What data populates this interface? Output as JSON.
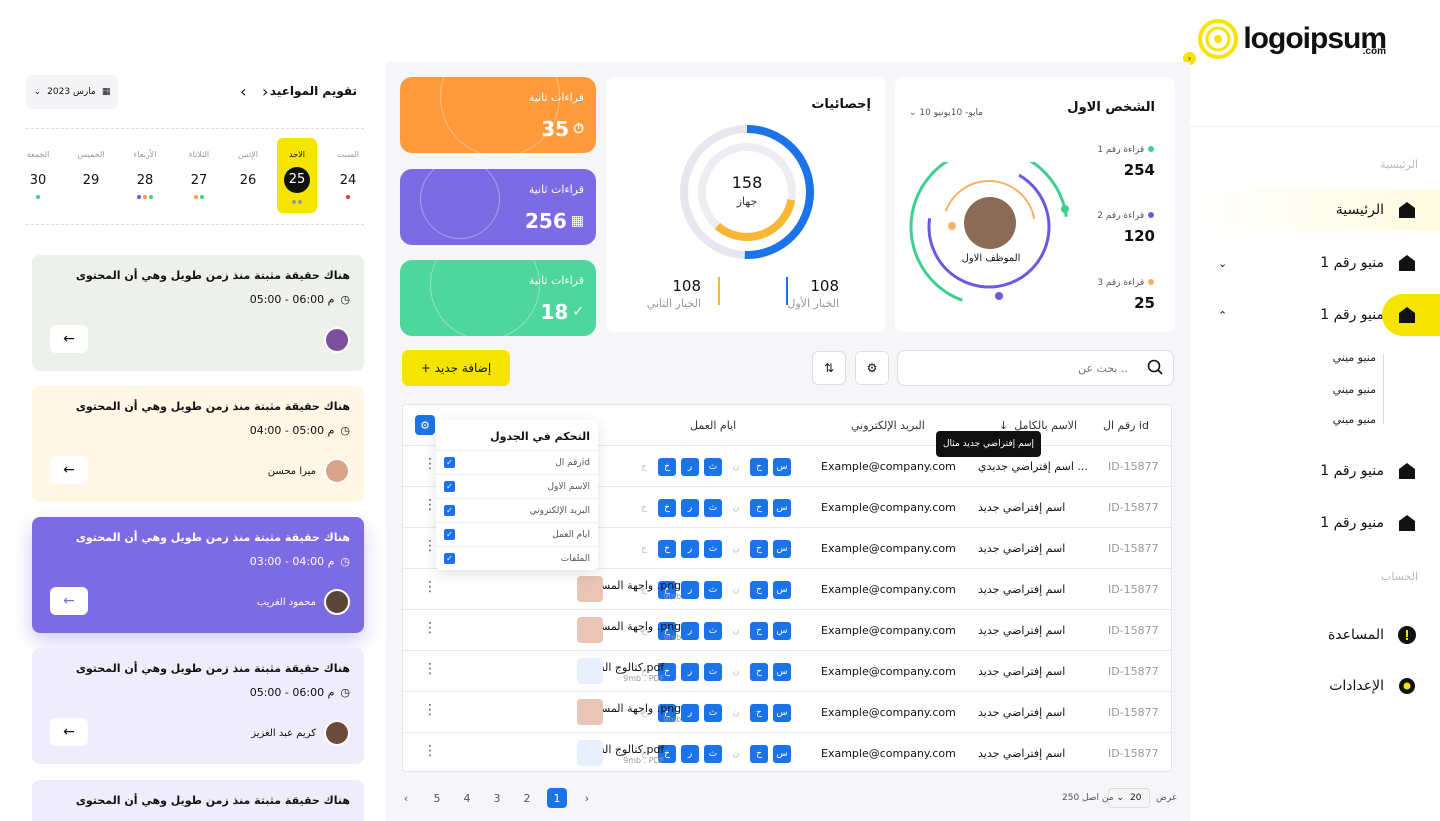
{
  "brand": {
    "name": "logoipsum",
    "suffix": ".com",
    "accent": "#f5e400",
    "blue": "#1a73e8"
  },
  "sidebar": {
    "section_main": "الرئيسية",
    "items": [
      {
        "label": "الرئيسية",
        "icon": "home-icon"
      },
      {
        "label": "منيو رقم 1",
        "icon": "home-icon"
      },
      {
        "label": "منيو رقم 1",
        "icon": "home-icon"
      },
      {
        "label": "منيو رقم 1",
        "icon": "home-icon"
      },
      {
        "label": "منيو رقم 1",
        "icon": "home-icon"
      }
    ],
    "subitems": [
      "منيو ميني",
      "منيو ميني",
      "منيو ميني"
    ],
    "section_account": "الحساب",
    "account_items": [
      {
        "label": "المساعدة",
        "icon": "help-icon"
      },
      {
        "label": "الإعدادات",
        "icon": "gear-icon"
      }
    ]
  },
  "profile": {
    "title": "الشخص الاول",
    "range": "10 مايو- 10يونيو",
    "name": "الموظف الاول",
    "stats": [
      {
        "label": "قراءة رقم 1",
        "value": "254",
        "color": "#3ecf8e"
      },
      {
        "label": "قراءة رقم 2",
        "value": "120",
        "color": "#6a5ae0"
      },
      {
        "label": "قراءة رقم 3",
        "value": "25",
        "color": "#f7b267"
      }
    ]
  },
  "stats": {
    "title": "إحصائيات",
    "center_value": "158",
    "center_label": "جهاز",
    "opt1_value": "108",
    "opt1_label": "الخيار الأول",
    "opt2_value": "108",
    "opt2_label": "الخيار الثاني"
  },
  "kpis": [
    {
      "label": "قراءات ثانية",
      "value": "35",
      "color": "#ff9a3c"
    },
    {
      "label": "قراءات ثانية",
      "value": "256",
      "color": "#7c6be3"
    },
    {
      "label": "قراءات ثانية",
      "value": "18",
      "color": "#4fd69c"
    }
  ],
  "toolbar": {
    "add_label": "+ إضافة جديد",
    "search_placeholder": "بحث عن .."
  },
  "table": {
    "headers": {
      "id": "رقم ال id",
      "name": "الاسم بالكامل",
      "email": "البريد الإلكتروني",
      "days": "ايام العمل",
      "files": "الملفات"
    },
    "days": [
      "س",
      "ح",
      "ن",
      "ث",
      "ر",
      "خ",
      "ج"
    ],
    "rows": [
      {
        "id": "ID-15877",
        "name": "اسم إفتراضي جديدي ...",
        "email": "Example@company.com",
        "file": "",
        "size": ""
      },
      {
        "id": "ID-15877",
        "name": "اسم إفتراضي جديد",
        "email": "Example@company.com",
        "file": "",
        "size": ""
      },
      {
        "id": "ID-15877",
        "name": "اسم إفتراضي جديد",
        "email": "Example@company.com",
        "file": "",
        "size": ""
      },
      {
        "id": "ID-15877",
        "name": "اسم إفتراضي جديد",
        "email": "Example@company.com",
        "file": "واجهة المستخدم .png",
        "size": "9mb"
      },
      {
        "id": "ID-15877",
        "name": "اسم إفتراضي جديد",
        "email": "Example@company.com",
        "file": "واجهة المستخدم .png",
        "size": "9mb"
      },
      {
        "id": "ID-15877",
        "name": "اسم إفتراضي جديد",
        "email": "Example@company.com",
        "file": "كتالوج الشركة.pdf",
        "size": "9mb . PDF"
      },
      {
        "id": "ID-15877",
        "name": "اسم إفتراضي جديد",
        "email": "Example@company.com",
        "file": "واجهة المستخدم .png",
        "size": "9mb"
      },
      {
        "id": "ID-15877",
        "name": "اسم إفتراضي جديد",
        "email": "Example@company.com",
        "file": "كتالوج الشركة.pdf",
        "size": "9mb . PDF"
      }
    ],
    "tooltip": "إسم إفتراضي جديد مثال",
    "popup": {
      "title": "التحكم في الجدول",
      "items": [
        "رقم الid",
        "الاسم الاول",
        "البريد الإلكتروني",
        "ايام العمل",
        "الملفات"
      ]
    }
  },
  "pagination": {
    "pages": [
      "1",
      "2",
      "3",
      "4",
      "5"
    ],
    "active": "1",
    "per_page": "20",
    "show": "عرض",
    "total": "من اصل 250"
  },
  "calendar": {
    "title": "تقويم المواعيد",
    "month": "مارس 2023",
    "days": [
      {
        "name": "السبت",
        "num": "24"
      },
      {
        "name": "الاحد",
        "num": "25"
      },
      {
        "name": "الإثنين",
        "num": "26"
      },
      {
        "name": "الثلاثاء",
        "num": "27"
      },
      {
        "name": "الأربعاء",
        "num": "28"
      },
      {
        "name": "الخميس",
        "num": "29"
      },
      {
        "name": "الجمعة",
        "num": "30"
      }
    ]
  },
  "appointments": [
    {
      "title": "هناك حقيقة مثبتة منذ زمن طويل وهي أن المحتوى",
      "time": "05:00 - 06:00 م",
      "person": ""
    },
    {
      "title": "هناك حقيقة مثبتة منذ زمن طويل وهي أن المحتوى",
      "time": "04:00 - 05:00 م",
      "person": "ميرا محسن"
    },
    {
      "title": "هناك حقيقة مثبتة منذ زمن طويل وهي أن المحتوى",
      "time": "03:00 - 04:00 م",
      "person": "محمود الغريب"
    },
    {
      "title": "هناك حقيقة مثبتة منذ زمن طويل وهي أن المحتوى",
      "time": "05:00 - 06:00 م",
      "person": "كريم عبد العزيز"
    },
    {
      "title": "هناك حقيقة مثبتة منذ زمن طويل وهي أن المحتوى",
      "time": "",
      "person": ""
    }
  ]
}
